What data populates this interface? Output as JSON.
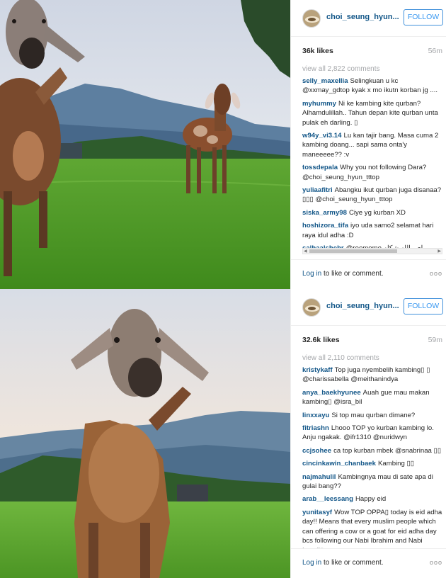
{
  "posts": [
    {
      "username": "choi_seung_hyun...",
      "follow_label": "FOLLOW",
      "likes": "36k likes",
      "time": "56m",
      "view_all": "view all 2,822 comments",
      "comments": [
        {
          "user": "selly_maxellia",
          "text": "Selingkuan u kc @xxmay_gdtop kyak x mo ikutn korban jg ...."
        },
        {
          "user": "myhummy",
          "text": "Ni ke kambing kite qurban? Alhamdulillah.. Tahun depan kite qurban unta pulak eh darling. ▯"
        },
        {
          "user": "w94y_vi3.14",
          "text": "Lu kan tajir bang. Masa cuma 2 kambing doang... sapi sama onta'y maneeeee?? :v"
        },
        {
          "user": "tossdepala",
          "text": "Why you not following Dara? @choi_seung_hyun_tttop"
        },
        {
          "user": "yuliaafitri",
          "text": "Abangku ikut qurban juga disanaa?▯▯▯ @choi_seung_hyun_tttop"
        },
        {
          "user": "siska_army98",
          "text": "Ciye yg kurban XD"
        },
        {
          "user": "hoshizora_tifa",
          "text": "iyo uda samo2 selamat hari raya idul adha :D"
        },
        {
          "user": "salhaalshehr",
          "text": "@reemome اي والله شكله"
        }
      ],
      "login_text": "Log in",
      "login_rest": "to like or comment.",
      "more": "ooo"
    },
    {
      "username": "choi_seung_hyun...",
      "follow_label": "FOLLOW",
      "likes": "32.6k likes",
      "time": "59m",
      "view_all": "view all 2,110 comments",
      "comments": [
        {
          "user": "kristykaff",
          "text": "Top juga nyembelih kambing▯ ▯ @charissabella @meithanindya"
        },
        {
          "user": "anya_baekhyunee",
          "text": "Auah gue mau makan kambing▯ @isra_bil"
        },
        {
          "user": "linxxayu",
          "text": "Si top mau qurban dimane?"
        },
        {
          "user": "fitriashn",
          "text": "Lhooo TOP yo kurban kambing lo. Anju ngakak. @ifr1310 @nuridwyn"
        },
        {
          "user": "ccjsohee",
          "text": "ca top kurban mbek @snabrinaa ▯▯"
        },
        {
          "user": "cincinkawin_chanbaek",
          "text": "Kambing ▯▯"
        },
        {
          "user": "najmahulil",
          "text": "Kambingnya mau di sate apa di gulai bang??"
        },
        {
          "user": "arab__leessang",
          "text": "Happy eid"
        },
        {
          "user": "yunitasyf",
          "text": "Wow TOP OPPA▯ today is eid adha day!! Means that every muslim people which can offering a cow or a goat for eid adha day bcs following our Nabi Ibrahim and Nabi Ismail▯"
        }
      ],
      "login_text": "Log in",
      "login_rest": "to like or comment.",
      "more": "ooo"
    }
  ]
}
